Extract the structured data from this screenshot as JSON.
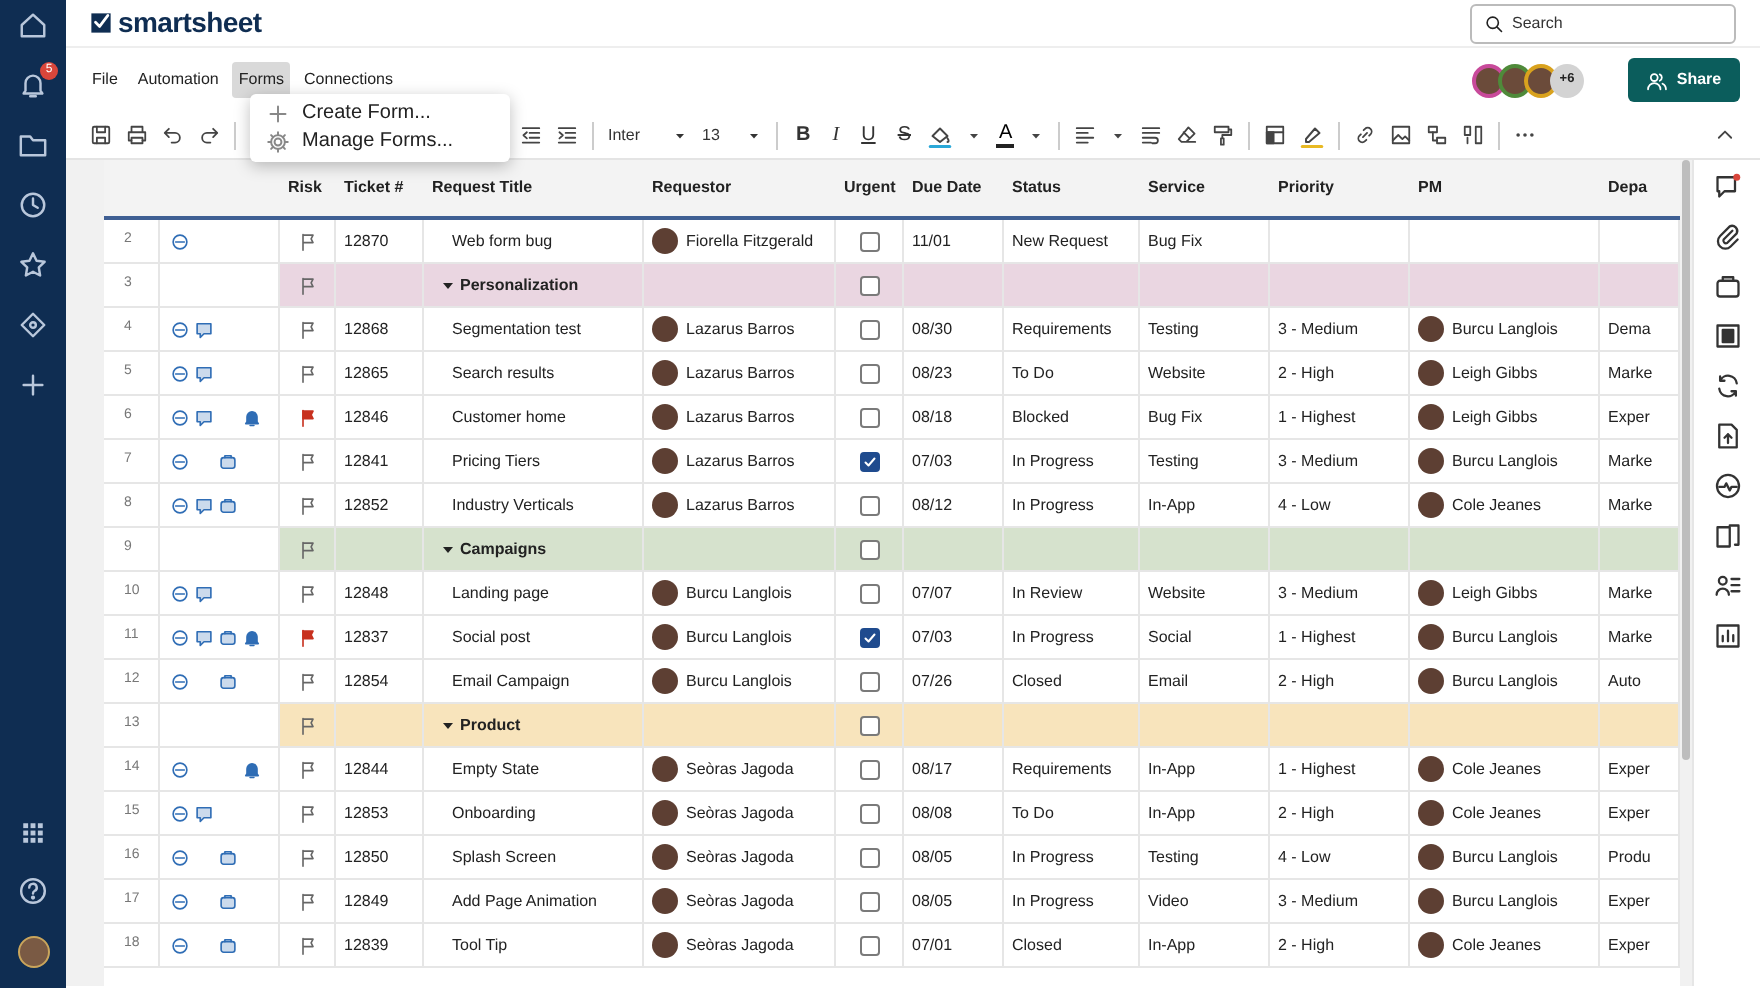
{
  "brand": {
    "name": "smartsheet"
  },
  "search": {
    "placeholder": "Search"
  },
  "nav": {
    "notification_badge": "5"
  },
  "menu": [
    {
      "label": "File",
      "selected": false
    },
    {
      "label": "Automation",
      "selected": false
    },
    {
      "label": "Forms",
      "selected": true
    },
    {
      "label": "Connections",
      "selected": false
    }
  ],
  "forms_menu": {
    "items": [
      {
        "kind": "create",
        "label": "Create Form..."
      },
      {
        "kind": "manage",
        "label": "Manage Forms..."
      }
    ]
  },
  "collaborators": {
    "more": "+6"
  },
  "share_button": {
    "label": "Share"
  },
  "toolbar": {
    "font": "Inter",
    "size": "13",
    "text_styles": [
      {
        "kind": "bold",
        "label": "B"
      },
      {
        "kind": "italic",
        "label": "I"
      },
      {
        "kind": "underline",
        "label": "U"
      },
      {
        "kind": "strike",
        "label": "S"
      }
    ],
    "text_color": {
      "label": "A"
    }
  },
  "columns": [
    "Risk",
    "Ticket #",
    "Request Title",
    "Requestor",
    "Urgent",
    "Due Date",
    "Status",
    "Service",
    "Priority",
    "PM",
    "Depa"
  ],
  "rows": [
    {
      "kind": "task",
      "number": "2",
      "indicators": [
        {
          "kind": "attachment"
        }
      ],
      "flagged": false,
      "ticket": "12870",
      "title": "Web form bug",
      "requestor": "Fiorella Fitzgerald",
      "urgent": false,
      "due": "11/01",
      "status": "New Request",
      "service": "Bug Fix"
    },
    {
      "kind": "section",
      "number": "3",
      "title": "Personalization",
      "color": "#ead6e1",
      "flagged": false,
      "urgent": false
    },
    {
      "kind": "task",
      "number": "4",
      "indicators": [
        {
          "kind": "attachment"
        },
        {
          "kind": "comment"
        }
      ],
      "flagged": false,
      "ticket": "12868",
      "title": "Segmentation test",
      "requestor": "Lazarus Barros",
      "urgent": false,
      "due": "08/30",
      "status": "Requirements",
      "service": "Testing",
      "priority": "3 - Medium",
      "pm": "Burcu Langlois",
      "department": "Dema"
    },
    {
      "kind": "task",
      "number": "5",
      "indicators": [
        {
          "kind": "attachment"
        },
        {
          "kind": "comment"
        }
      ],
      "flagged": false,
      "ticket": "12865",
      "title": "Search results",
      "requestor": "Lazarus Barros",
      "urgent": false,
      "due": "08/23",
      "status": "To Do",
      "service": "Website",
      "priority": "2 - High",
      "pm": "Leigh Gibbs",
      "department": "Marke"
    },
    {
      "kind": "task",
      "number": "6",
      "indicators": [
        {
          "kind": "attachment"
        },
        {
          "kind": "comment"
        },
        {
          "kind": "reminder"
        }
      ],
      "flagged": true,
      "ticket": "12846",
      "title": "Customer home",
      "requestor": "Lazarus Barros",
      "urgent": false,
      "due": "08/18",
      "status": "Blocked",
      "service": "Bug Fix",
      "priority": "1 - Highest",
      "pm": "Leigh Gibbs",
      "department": "Exper"
    },
    {
      "kind": "task",
      "number": "7",
      "indicators": [
        {
          "kind": "attachment"
        },
        {
          "kind": "proof"
        }
      ],
      "flagged": false,
      "ticket": "12841",
      "title": "Pricing Tiers",
      "requestor": "Lazarus Barros",
      "urgent": true,
      "due": "07/03",
      "status": "In Progress",
      "service": "Testing",
      "priority": "3 - Medium",
      "pm": "Burcu Langlois",
      "department": "Marke"
    },
    {
      "kind": "task",
      "number": "8",
      "indicators": [
        {
          "kind": "attachment"
        },
        {
          "kind": "comment"
        },
        {
          "kind": "proof"
        }
      ],
      "flagged": false,
      "ticket": "12852",
      "title": "Industry Verticals",
      "requestor": "Lazarus Barros",
      "urgent": false,
      "due": "08/12",
      "status": "In Progress",
      "service": "In-App",
      "priority": "4 - Low",
      "pm": "Cole Jeanes",
      "department": "Marke"
    },
    {
      "kind": "section",
      "number": "9",
      "title": "Campaigns",
      "color": "#d6e2cd",
      "flagged": false,
      "urgent": false
    },
    {
      "kind": "task",
      "number": "10",
      "indicators": [
        {
          "kind": "attachment"
        },
        {
          "kind": "comment"
        }
      ],
      "flagged": false,
      "ticket": "12848",
      "title": "Landing page",
      "requestor": "Burcu Langlois",
      "urgent": false,
      "due": "07/07",
      "status": "In Review",
      "service": "Website",
      "priority": "3 - Medium",
      "pm": "Leigh Gibbs",
      "department": "Marke"
    },
    {
      "kind": "task",
      "number": "11",
      "indicators": [
        {
          "kind": "attachment"
        },
        {
          "kind": "comment"
        },
        {
          "kind": "proof"
        },
        {
          "kind": "reminder"
        }
      ],
      "flagged": true,
      "ticket": "12837",
      "title": "Social post",
      "requestor": "Burcu Langlois",
      "urgent": true,
      "due": "07/03",
      "status": "In Progress",
      "service": "Social",
      "priority": "1 - Highest",
      "pm": "Burcu Langlois",
      "department": "Marke"
    },
    {
      "kind": "task",
      "number": "12",
      "indicators": [
        {
          "kind": "attachment"
        },
        {
          "kind": "proof"
        }
      ],
      "flagged": false,
      "ticket": "12854",
      "title": "Email Campaign",
      "requestor": "Burcu Langlois",
      "urgent": false,
      "due": "07/26",
      "status": "Closed",
      "service": "Email",
      "priority": "2 - High",
      "pm": "Burcu Langlois",
      "department": "Auto"
    },
    {
      "kind": "section",
      "number": "13",
      "title": "Product",
      "color": "#f8e4bc",
      "flagged": false,
      "urgent": false
    },
    {
      "kind": "task",
      "number": "14",
      "indicators": [
        {
          "kind": "attachment"
        },
        {
          "kind": "reminder"
        }
      ],
      "flagged": false,
      "ticket": "12844",
      "title": "Empty State",
      "requestor": "Seòras Jagoda",
      "urgent": false,
      "due": "08/17",
      "status": "Requirements",
      "service": "In-App",
      "priority": "1 - Highest",
      "pm": "Cole Jeanes",
      "department": "Exper"
    },
    {
      "kind": "task",
      "number": "15",
      "indicators": [
        {
          "kind": "attachment"
        },
        {
          "kind": "comment"
        }
      ],
      "flagged": false,
      "ticket": "12853",
      "title": "Onboarding",
      "requestor": "Seòras Jagoda",
      "urgent": false,
      "due": "08/08",
      "status": "To Do",
      "service": "In-App",
      "priority": "2 - High",
      "pm": "Cole Jeanes",
      "department": "Exper"
    },
    {
      "kind": "task",
      "number": "16",
      "indicators": [
        {
          "kind": "attachment"
        },
        {
          "kind": "proof"
        }
      ],
      "flagged": false,
      "ticket": "12850",
      "title": "Splash Screen",
      "requestor": "Seòras Jagoda",
      "urgent": false,
      "due": "08/05",
      "status": "In Progress",
      "service": "Testing",
      "priority": "4 - Low",
      "pm": "Burcu Langlois",
      "department": "Produ"
    },
    {
      "kind": "task",
      "number": "17",
      "indicators": [
        {
          "kind": "attachment"
        },
        {
          "kind": "proof"
        }
      ],
      "flagged": false,
      "ticket": "12849",
      "title": "Add Page Animation",
      "requestor": "Seòras Jagoda",
      "urgent": false,
      "due": "08/05",
      "status": "In Progress",
      "service": "Video",
      "priority": "3 - Medium",
      "pm": "Burcu Langlois",
      "department": "Exper"
    },
    {
      "kind": "task",
      "number": "18",
      "indicators": [
        {
          "kind": "attachment"
        },
        {
          "kind": "proof"
        }
      ],
      "flagged": false,
      "ticket": "12839",
      "title": "Tool Tip",
      "requestor": "Seòras Jagoda",
      "urgent": false,
      "due": "07/01",
      "status": "Closed",
      "service": "In-App",
      "priority": "2 - High",
      "pm": "Cole Jeanes",
      "department": "Exper"
    }
  ]
}
